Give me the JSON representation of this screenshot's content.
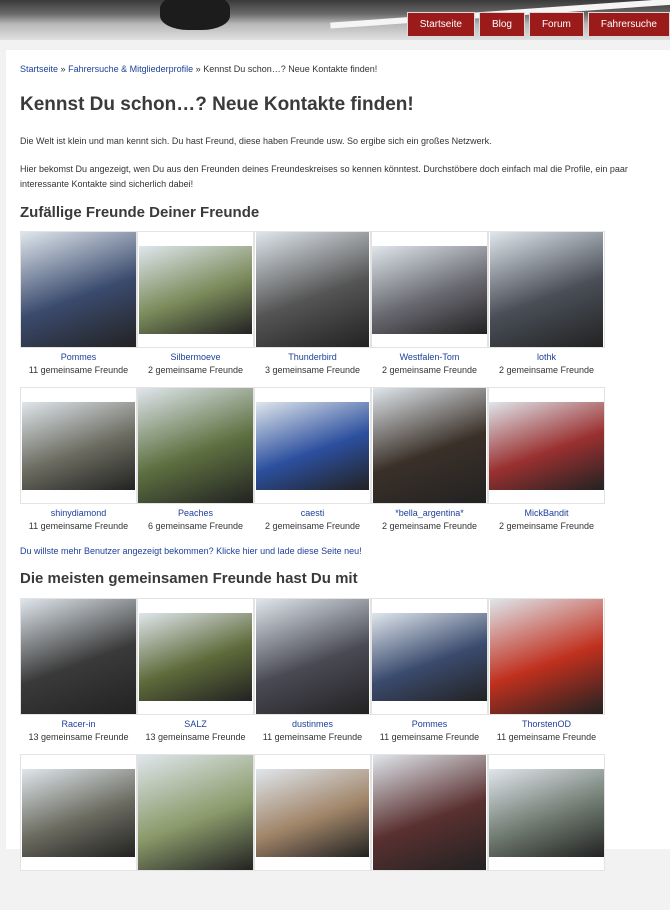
{
  "nav": [
    "Startseite",
    "Blog",
    "Forum",
    "Fahrersuche"
  ],
  "breadcrumb": {
    "home": "Startseite",
    "sep1": "»",
    "section": "Fahrersuche & Mitgliederprofile",
    "sep2": "»",
    "current": "Kennst Du schon…? Neue Kontakte finden!"
  },
  "title": "Kennst Du schon…? Neue Kontakte finden!",
  "intro1": "Die Welt ist klein und man kennt sich. Du hast Freund, diese haben Freunde usw. So ergibe sich ein großes Netzwerk.",
  "intro2": "Hier bekomst Du angezeigt, wen Du aus den Freunden deines Freundeskreises so kennen könntest. Durchstöbere doch einfach mal die Profile, ein paar interessante Kontakte sind sicherlich dabei!",
  "section1": "Zufällige Freunde Deiner Freunde",
  "random_friends": [
    {
      "name": "Pommes",
      "mutual": "11 gemeinsame Freunde",
      "color": "#3b4b6e"
    },
    {
      "name": "Silbermoeve",
      "mutual": "2 gemeinsame Freunde",
      "color": "#7a8a5a"
    },
    {
      "name": "Thunderbird",
      "mutual": "3 gemeinsame Freunde",
      "color": "#555555"
    },
    {
      "name": "Westfalen-Tom",
      "mutual": "2 gemeinsame Freunde",
      "color": "#6a6a72"
    },
    {
      "name": "lothk",
      "mutual": "2 gemeinsame Freunde",
      "color": "#4a4f58"
    },
    {
      "name": "shinydiamond",
      "mutual": "11 gemeinsame Freunde",
      "color": "#6b6b60"
    },
    {
      "name": "Peaches",
      "mutual": "6 gemeinsame Freunde",
      "color": "#5d7040"
    },
    {
      "name": "caesti",
      "mutual": "2 gemeinsame Freunde",
      "color": "#2c4f9e"
    },
    {
      "name": "*bella_argentina*",
      "mutual": "2 gemeinsame Freunde",
      "color": "#3a3028"
    },
    {
      "name": "MickBandit",
      "mutual": "2 gemeinsame Freunde",
      "color": "#9a3030"
    }
  ],
  "reload_link": "Du willste mehr Benutzer angezeigt bekommen? Klicke hier und lade diese Seite neu!",
  "section2": "Die meisten gemeinsamen Freunde hast Du mit",
  "top_friends": [
    {
      "name": "Racer-in",
      "mutual": "13 gemeinsame Freunde",
      "color": "#3a3a3a"
    },
    {
      "name": "SALZ",
      "mutual": "13 gemeinsame Freunde",
      "color": "#5e6a3a"
    },
    {
      "name": "dustinmes",
      "mutual": "11 gemeinsame Freunde",
      "color": "#4a4a55"
    },
    {
      "name": "Pommes",
      "mutual": "11 gemeinsame Freunde",
      "color": "#3b4b6e"
    },
    {
      "name": "ThorstenOD",
      "mutual": "11 gemeinsame Freunde",
      "color": "#c0301e"
    },
    {
      "name": "",
      "mutual": "",
      "color": "#6b6b60"
    },
    {
      "name": "",
      "mutual": "",
      "color": "#8a9a6a"
    },
    {
      "name": "",
      "mutual": "",
      "color": "#a08468"
    },
    {
      "name": "",
      "mutual": "",
      "color": "#5a3030"
    },
    {
      "name": "",
      "mutual": "",
      "color": "#6f7a70"
    }
  ]
}
